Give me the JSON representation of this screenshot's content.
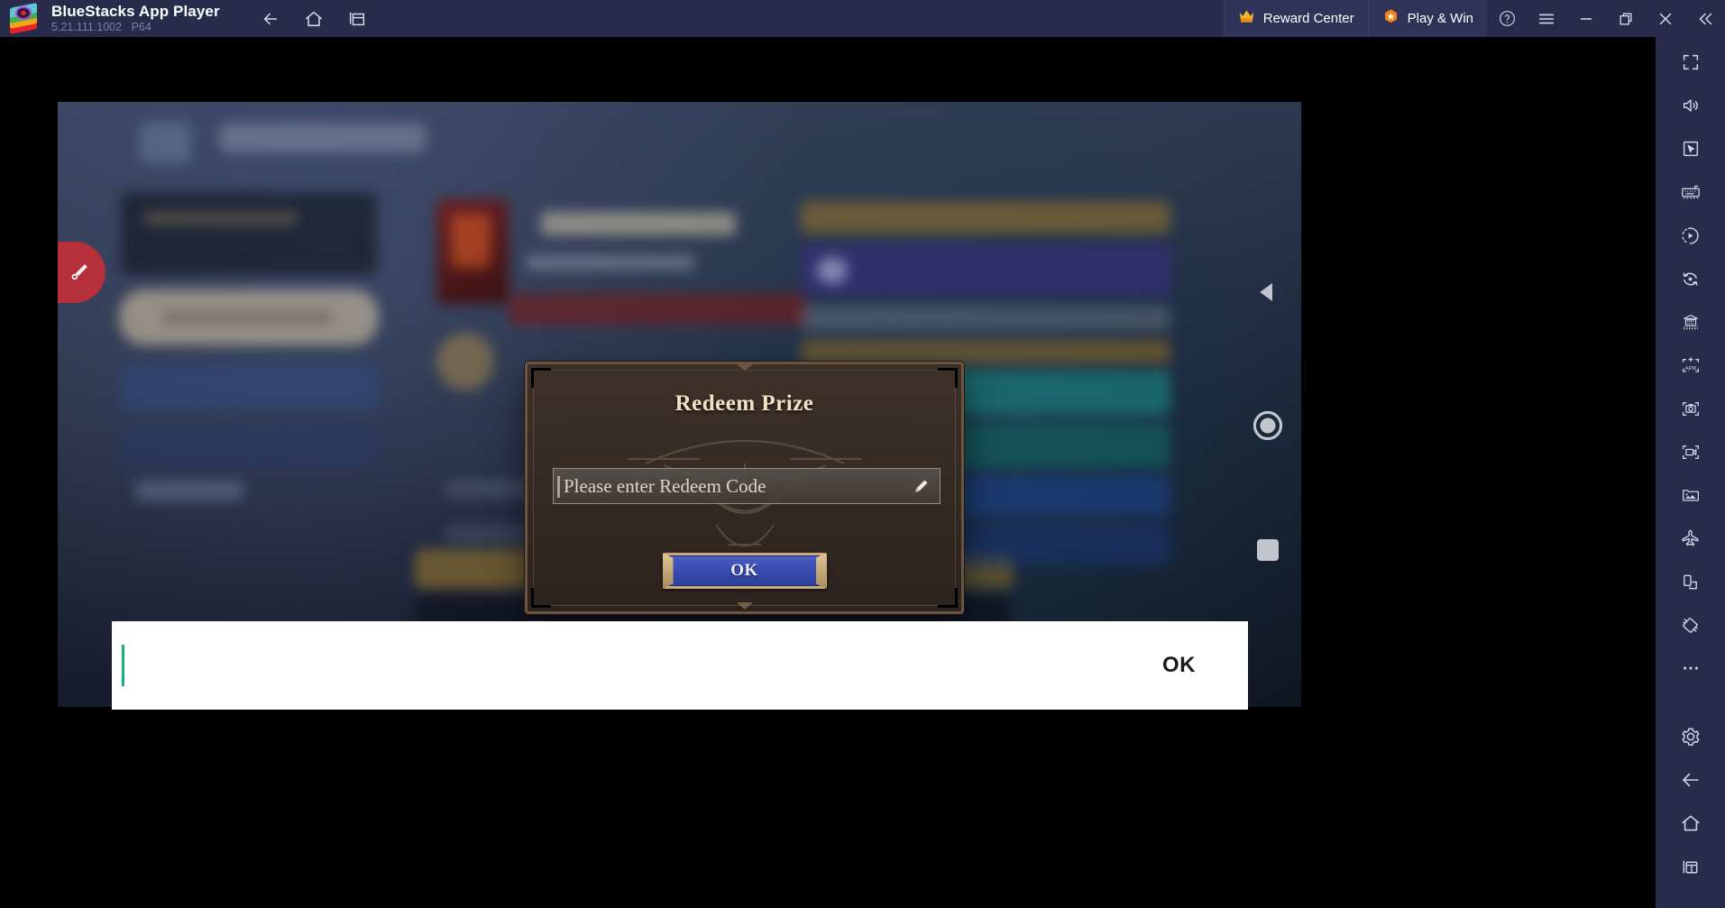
{
  "titlebar": {
    "logo_icon": "bluestacks-logo-icon",
    "app_title": "BlueStacks App Player",
    "version": "5.21.111.1002",
    "bitness": "P64",
    "nav": [
      {
        "name": "back-icon",
        "label": "Back"
      },
      {
        "name": "home-icon",
        "label": "Home"
      },
      {
        "name": "multi-instance-icon",
        "label": "Multi-instance"
      }
    ],
    "reward_center": {
      "label": "Reward Center",
      "icon": "crown-icon"
    },
    "play_and_win": {
      "label": "Play & Win",
      "icon": "star-badge-icon"
    },
    "window_controls": [
      {
        "name": "help-icon",
        "label": "Help"
      },
      {
        "name": "hamburger-menu-icon",
        "label": "Menu"
      },
      {
        "name": "minimize-icon",
        "label": "Minimize"
      },
      {
        "name": "restore-icon",
        "label": "Restore"
      },
      {
        "name": "close-icon",
        "label": "Close"
      },
      {
        "name": "collapse-sidebar-icon",
        "label": "Collapse"
      }
    ]
  },
  "dialog": {
    "title": "Redeem Prize",
    "input_placeholder": "Please enter Redeem Code",
    "input_value": "",
    "pencil_icon": "pencil-edit-icon",
    "ok_label": "OK"
  },
  "ime_bar": {
    "input_value": "",
    "ok_label": "OK"
  },
  "android_nav": [
    {
      "name": "android-back-button",
      "label": "Back"
    },
    {
      "name": "android-home-button",
      "label": "Home"
    },
    {
      "name": "android-recents-button",
      "label": "Recents"
    }
  ],
  "game_side_tab": {
    "name": "brush-tool-tab",
    "label": "Brush"
  },
  "sidebar": {
    "items": [
      {
        "name": "fullscreen-icon",
        "label": "Full screen"
      },
      {
        "name": "volume-icon",
        "label": "Volume"
      },
      {
        "name": "cursor-pointer-icon",
        "label": "Game controls"
      },
      {
        "name": "keyboard-icon",
        "label": "Keyboard controls"
      },
      {
        "name": "macro-play-icon",
        "label": "Macro recorder"
      },
      {
        "name": "sync-operations-icon",
        "label": "Sync operations"
      },
      {
        "name": "multi-instance-manager-icon",
        "label": "Multi-instance manager"
      },
      {
        "name": "install-apk-icon",
        "label": "Install APK"
      },
      {
        "name": "screenshot-icon",
        "label": "Screenshot"
      },
      {
        "name": "record-screen-icon",
        "label": "Record screen"
      },
      {
        "name": "media-manager-icon",
        "label": "Media manager"
      },
      {
        "name": "location-airplane-icon",
        "label": "Location"
      },
      {
        "name": "shake-device-icon",
        "label": "Shake"
      },
      {
        "name": "rotate-icon",
        "label": "Rotate"
      },
      {
        "name": "more-options-icon",
        "label": "More"
      },
      {
        "name": "settings-gear-icon",
        "label": "Settings"
      },
      {
        "name": "back-arrow-icon",
        "label": "Back"
      },
      {
        "name": "home-outline-icon",
        "label": "Home"
      },
      {
        "name": "recents-panel-icon",
        "label": "Recent apps"
      }
    ]
  },
  "colors": {
    "titlebar_bg": "#282c4a",
    "sidebar_bg": "#282c4a",
    "pill_bg": "#2f3357",
    "accent_orange": "#f5a623",
    "ime_caret": "#14b07f",
    "dialog_border": "#6a5544",
    "dialog_title": "#f2e2c4",
    "ok_button_blue": "#3a4bb0",
    "side_tab_red": "#b5303a"
  }
}
